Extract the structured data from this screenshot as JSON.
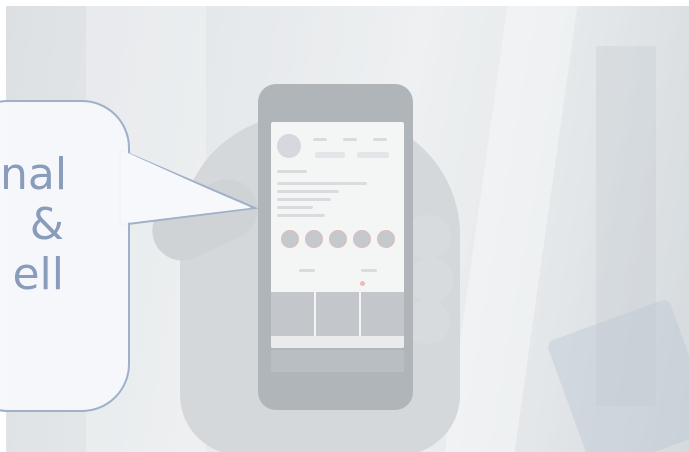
{
  "speech_bubble": {
    "lines": [
      "nal",
      "&",
      "ell"
    ],
    "text_color": "#8a9cbc",
    "border_color": "#9fb0c8"
  },
  "photo": {
    "subject": "hand-holding-smartphone-icon",
    "tint": "#dfe3e6"
  }
}
